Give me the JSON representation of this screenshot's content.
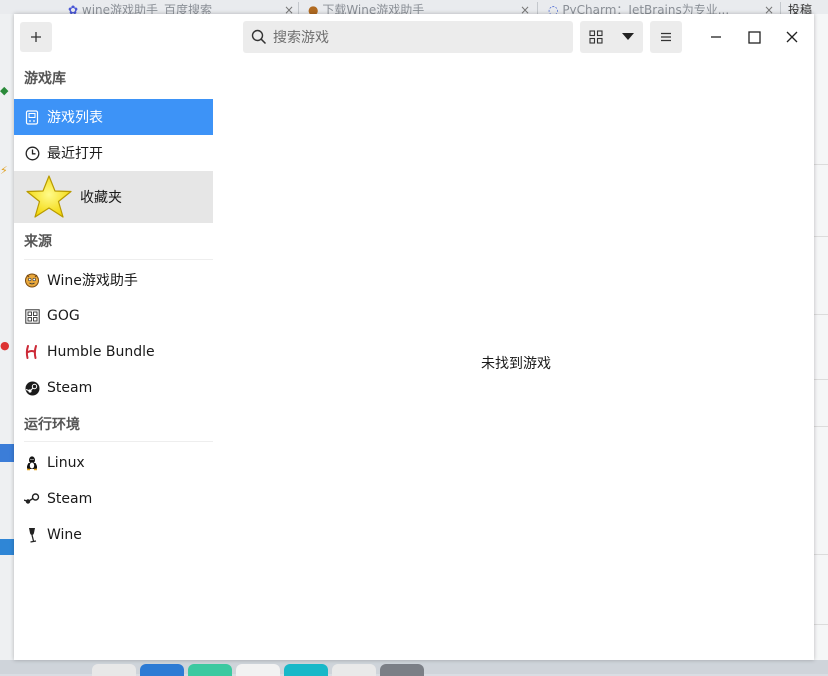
{
  "background": {
    "tabs": [
      {
        "title": "wine游戏助手_百度搜索"
      },
      {
        "title": "下载Wine游戏助手"
      },
      {
        "title": "PyCharm：JetBrains为专业..."
      },
      {
        "title": "投稿"
      }
    ],
    "close_glyph": "×"
  },
  "header": {
    "add_button_icon": "plus-icon",
    "search": {
      "placeholder": "搜索游戏",
      "value": ""
    },
    "view_toggle_icon": "grid-icon",
    "view_dropdown_icon": "caret-down-icon",
    "menu_icon": "hamburger-icon",
    "window_controls": [
      "minimize-icon",
      "maximize-icon",
      "close-icon"
    ]
  },
  "sidebar": {
    "sections": [
      {
        "title": "游戏库",
        "items": [
          {
            "label": "游戏列表",
            "icon": "gamepad-icon",
            "selected": true
          },
          {
            "label": "最近打开",
            "icon": "clock-icon",
            "selected": false
          },
          {
            "label": "收藏夹",
            "icon": "star-icon",
            "selected": false
          }
        ]
      },
      {
        "title": "来源",
        "items": [
          {
            "label": "Wine游戏助手",
            "icon": "wine-helper-icon"
          },
          {
            "label": "GOG",
            "icon": "gog-icon"
          },
          {
            "label": "Humble Bundle",
            "icon": "humble-bundle-icon"
          },
          {
            "label": "Steam",
            "icon": "steam-icon"
          }
        ]
      },
      {
        "title": "运行环境",
        "items": [
          {
            "label": "Linux",
            "icon": "linux-tux-icon"
          },
          {
            "label": "Steam",
            "icon": "steam-runner-icon"
          },
          {
            "label": "Wine",
            "icon": "wine-glass-icon"
          }
        ]
      }
    ]
  },
  "main": {
    "empty_message": "未找到游戏"
  },
  "colors": {
    "selected": "#3d93f7",
    "favorites_bg": "#e6e6e6",
    "control_bg": "#ececec"
  }
}
